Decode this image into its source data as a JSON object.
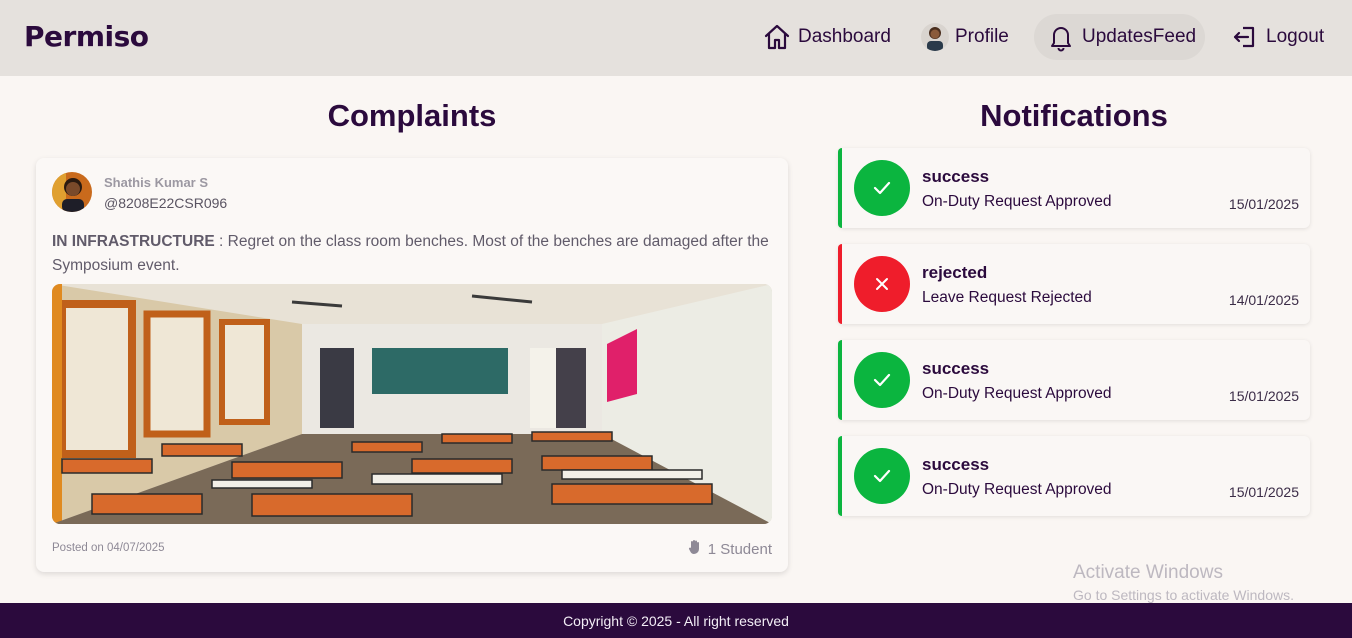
{
  "header": {
    "brand": "Permiso",
    "nav": {
      "dashboard": "Dashboard",
      "profile": "Profile",
      "updates": "UpdatesFeed",
      "logout": "Logout"
    }
  },
  "complaints": {
    "title": "Complaints",
    "post": {
      "author_name": "Shathis Kumar S",
      "author_handle": "@8208E22CSR096",
      "category": "IN INFRASTRUCTURE",
      "separator": " : ",
      "text": "Regret on the class room benches. Most of the benches are damaged after the Symposium event.",
      "posted": "Posted on 04/07/2025",
      "support": "1 Student"
    }
  },
  "notifications": {
    "title": "Notifications",
    "items": [
      {
        "status": "success",
        "message": "On-Duty Request Approved",
        "date": "15/01/2025"
      },
      {
        "status": "rejected",
        "message": "Leave Request Rejected",
        "date": "14/01/2025"
      },
      {
        "status": "success",
        "message": "On-Duty Request Approved",
        "date": "15/01/2025"
      },
      {
        "status": "success",
        "message": "On-Duty Request Approved",
        "date": "15/01/2025"
      }
    ]
  },
  "watermark": {
    "line1": "Activate Windows",
    "line2": "Go to Settings to activate Windows."
  },
  "footer": {
    "copyright": "Copyright © 2025 - All right reserved"
  },
  "colors": {
    "brand": "#2b0a3d",
    "success": "#0bb53f",
    "rejected": "#ef1d2b",
    "topbar": "#e5e1dd"
  }
}
